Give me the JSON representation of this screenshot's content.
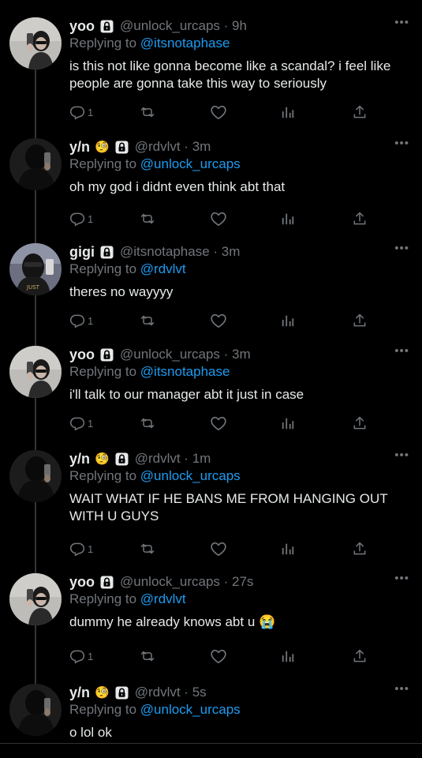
{
  "tweets": [
    {
      "name": "yoo",
      "emoji": "",
      "handle": "@unlock_urcaps",
      "time": "9h",
      "replying_prefix": "Replying to ",
      "replying_to": "@itsnotaphase",
      "text": "is this not like gonna become like a scandal? i feel like people are gonna take this way to seriously",
      "reply_count": "1",
      "avatar": "yoo"
    },
    {
      "name": "y/n",
      "emoji": "🧐",
      "handle": "@rdvlvt",
      "time": "3m",
      "replying_prefix": "Replying to ",
      "replying_to": "@unlock_urcaps",
      "text": "oh my god i didnt even think abt that",
      "reply_count": "1",
      "avatar": "yn"
    },
    {
      "name": "gigi",
      "emoji": "",
      "handle": "@itsnotaphase",
      "time": "3m",
      "replying_prefix": "Replying to ",
      "replying_to": "@rdvlvt",
      "text": "theres no wayyyy",
      "reply_count": "1",
      "avatar": "gigi"
    },
    {
      "name": "yoo",
      "emoji": "",
      "handle": "@unlock_urcaps",
      "time": "3m",
      "replying_prefix": "Replying to ",
      "replying_to": "@itsnotaphase",
      "text": "i'll talk to our manager abt it just in case",
      "reply_count": "1",
      "avatar": "yoo"
    },
    {
      "name": "y/n",
      "emoji": "🧐",
      "handle": "@rdvlvt",
      "time": "1m",
      "replying_prefix": "Replying to ",
      "replying_to": "@unlock_urcaps",
      "text": "WAIT WHAT IF HE BANS ME FROM HANGING OUT WITH U GUYS",
      "reply_count": "1",
      "avatar": "yn"
    },
    {
      "name": "yoo",
      "emoji": "",
      "handle": "@unlock_urcaps",
      "time": "27s",
      "replying_prefix": "Replying to ",
      "replying_to": "@rdvlvt",
      "text": "dummy he already knows abt u 😭",
      "reply_count": "1",
      "avatar": "yoo"
    },
    {
      "name": "y/n",
      "emoji": "🧐",
      "handle": "@rdvlvt",
      "time": "5s",
      "replying_prefix": "Replying to ",
      "replying_to": "@unlock_urcaps",
      "text": "o lol ok",
      "reply_count": "",
      "avatar": "yn"
    }
  ],
  "more_label": "•••",
  "separator": " · ",
  "icons": {
    "reply": "reply-icon",
    "retweet": "retweet-icon",
    "like": "heart-icon",
    "analytics": "analytics-icon",
    "share": "share-icon",
    "lock": "lock-icon"
  },
  "colors": {
    "link": "#1d9bf0",
    "muted": "#71767b",
    "text": "#e7e9ea",
    "background": "#000000"
  }
}
